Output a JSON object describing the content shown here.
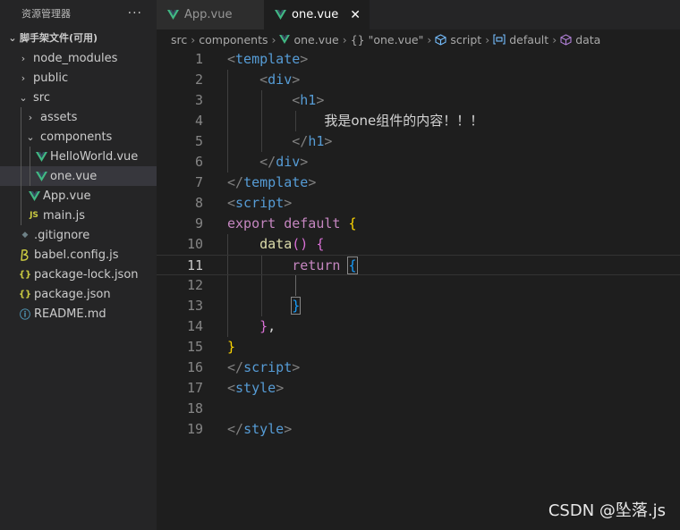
{
  "sidebar": {
    "title": "资源管理器",
    "more": "···",
    "tree": [
      {
        "label": "脚手架文件(可用)",
        "chevron": "⌄",
        "icon": ""
      },
      {
        "label": "node_modules",
        "chevron": "›",
        "icon": ""
      },
      {
        "label": "public",
        "chevron": "›",
        "icon": ""
      },
      {
        "label": "src",
        "chevron": "⌄",
        "icon": ""
      },
      {
        "label": "assets",
        "chevron": "›",
        "icon": ""
      },
      {
        "label": "components",
        "chevron": "⌄",
        "icon": ""
      },
      {
        "label": "HelloWorld.vue",
        "chevron": "",
        "icon": "vue"
      },
      {
        "label": "one.vue",
        "chevron": "",
        "icon": "vue"
      },
      {
        "label": "App.vue",
        "chevron": "",
        "icon": "vue"
      },
      {
        "label": "main.js",
        "chevron": "",
        "icon": "JS"
      },
      {
        "label": ".gitignore",
        "chevron": "",
        "icon": "◆"
      },
      {
        "label": "babel.config.js",
        "chevron": "",
        "icon": "babel"
      },
      {
        "label": "package-lock.json",
        "chevron": "",
        "icon": "{}"
      },
      {
        "label": "package.json",
        "chevron": "",
        "icon": "{}"
      },
      {
        "label": "README.md",
        "chevron": "",
        "icon": "ⓘ"
      }
    ]
  },
  "tabs": [
    {
      "label": "App.vue"
    },
    {
      "label": "one.vue",
      "close": "✕"
    }
  ],
  "breadcrumb": {
    "items": [
      "src",
      "components",
      "one.vue",
      "{} \"one.vue\"",
      "script",
      "default",
      "data"
    ],
    "sep": "›"
  },
  "editor": {
    "lines": [
      "1",
      "2",
      "3",
      "4",
      "5",
      "6",
      "7",
      "8",
      "9",
      "10",
      "11",
      "12",
      "13",
      "14",
      "15",
      "16",
      "17",
      "18",
      "19"
    ],
    "current_line": "11",
    "text_content": "我是one组件的内容！！！"
  },
  "watermark": "CSDN @坠落.js",
  "colors": {
    "vue": "#41b883",
    "js": "#cbcb41",
    "json": "#cbcb41",
    "info": "#519aba"
  }
}
